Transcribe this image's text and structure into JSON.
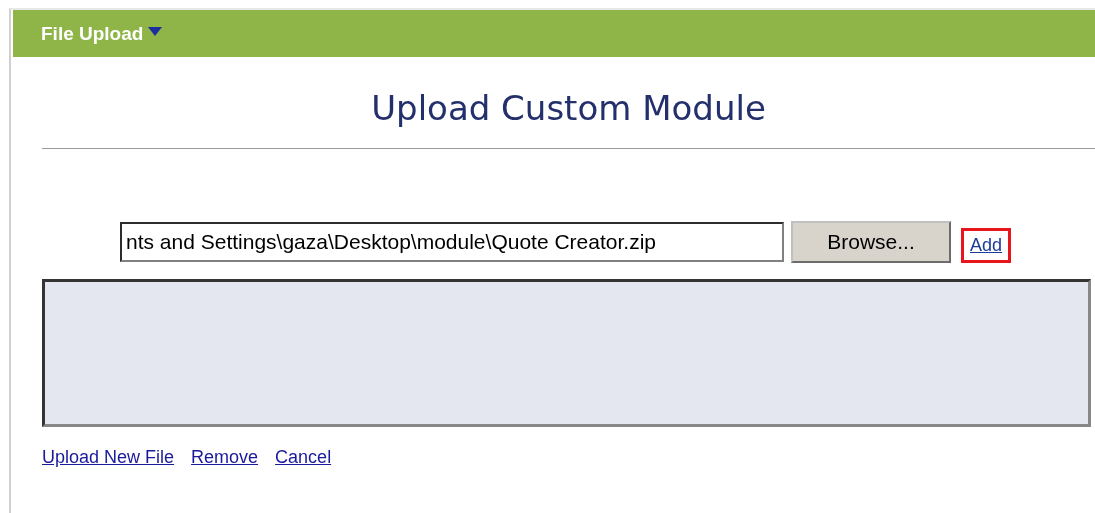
{
  "header": {
    "title": "File Upload"
  },
  "page_title": "Upload Custom Module",
  "file_field": {
    "value": "nts and Settings\\gaza\\Desktop\\module\\Quote Creator.zip"
  },
  "browse_button": "Browse...",
  "add_link": {
    "label": "Add",
    "highlighted": true
  },
  "links": [
    "Upload New File",
    "Remove",
    "Cancel"
  ]
}
